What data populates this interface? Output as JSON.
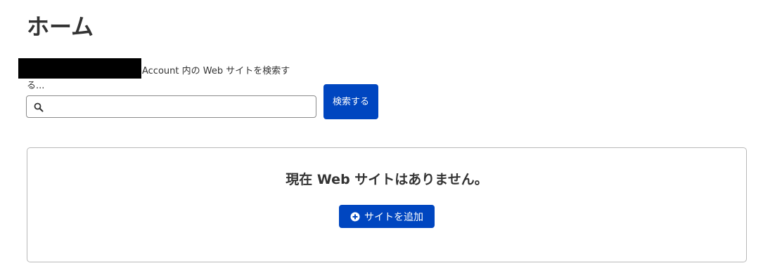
{
  "page": {
    "title": "ホーム"
  },
  "search": {
    "label": "Account 内の Web サイトを検索する...",
    "input_value": "",
    "icon": "search-icon",
    "button_label": "検索する"
  },
  "empty_state": {
    "message": "現在 Web サイトはありません。",
    "add_button_label": "サイトを追加",
    "add_button_icon": "plus-circle-icon"
  },
  "colors": {
    "primary_button": "#0046c0",
    "text": "#333333",
    "redaction": "#000000"
  }
}
